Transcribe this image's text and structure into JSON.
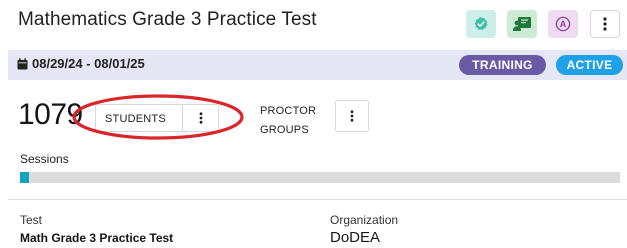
{
  "header": {
    "title": "Mathematics Grade 3 Practice Test",
    "actions": [
      {
        "icon": "check-badge-icon",
        "color": "#3fbfa8"
      },
      {
        "icon": "person-board-icon",
        "color": "#1f7a3a"
      },
      {
        "icon": "circle-a-icon",
        "glyph": "A",
        "color": "#8b3aa0"
      },
      {
        "icon": "more-vertical-icon"
      }
    ]
  },
  "date_band": {
    "icon": "calendar-icon",
    "date_range": "08/29/24 - 08/01/25",
    "badges": [
      {
        "label": "TRAINING",
        "color": "#6a5aa6"
      },
      {
        "label": "ACTIVE",
        "color": "#1ea1e9"
      }
    ]
  },
  "stats": {
    "student_count": "1079",
    "students_button_label": "STUDENTS",
    "proctor_groups_label_line1": "PROCTOR",
    "proctor_groups_label_line2": "GROUPS",
    "annotation_color": "#d8262b"
  },
  "sessions": {
    "label": "Sessions",
    "progress_fraction": 0.015,
    "fill_color": "#16a3bd"
  },
  "details": {
    "test_label": "Test",
    "test_value": "Math Grade 3 Practice Test",
    "organization_label": "Organization",
    "organization_value": "DoDEA"
  }
}
